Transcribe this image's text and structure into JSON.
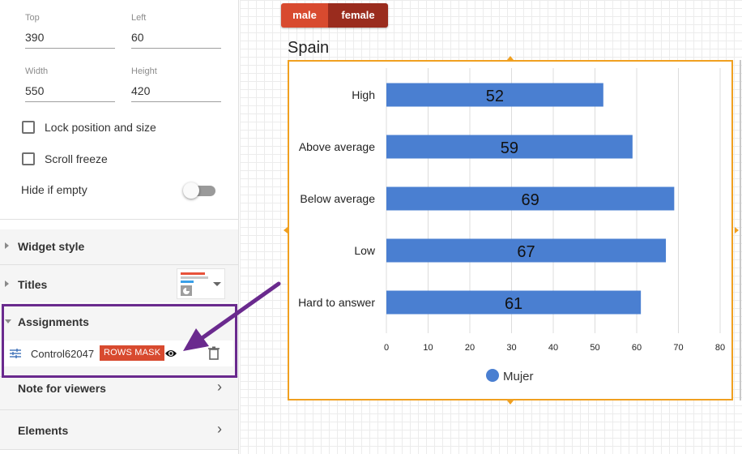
{
  "panel": {
    "position": {
      "top_label": "Top",
      "top_value": "390",
      "left_label": "Left",
      "left_value": "60",
      "width_label": "Width",
      "width_value": "550",
      "height_label": "Height",
      "height_value": "420"
    },
    "lock_label": "Lock position and size",
    "scroll_freeze_label": "Scroll freeze",
    "hide_if_empty_label": "Hide if empty",
    "sections": {
      "widget_style": "Widget style",
      "titles": "Titles",
      "assignments": "Assignments",
      "note_for_viewers": "Note for viewers",
      "elements": "Elements"
    },
    "assignment": {
      "name": "Control62047",
      "badge": "ROWS MASK"
    }
  },
  "filter_buttons": {
    "male": "male",
    "female": "female"
  },
  "chart_data": {
    "type": "bar",
    "orientation": "horizontal",
    "title": "Spain",
    "categories": [
      "High",
      "Above average",
      "Below average",
      "Low",
      "Hard to answer"
    ],
    "series": [
      {
        "name": "Mujer",
        "values": [
          52,
          59,
          69,
          67,
          61
        ],
        "color": "#4a7fd1"
      }
    ],
    "xlim": [
      0,
      80
    ],
    "x_ticks": [
      0,
      10,
      20,
      30,
      40,
      50,
      60,
      70,
      80
    ],
    "grid": "vertical",
    "legend_position": "bottom-center",
    "data_labels": "inside-bar-center"
  },
  "colors": {
    "accent_red": "#d84a2f",
    "dark_red": "#9a2c1e",
    "selection_orange": "#f0a020",
    "annotation_purple": "#6a2a8e",
    "bar_blue": "#4a7fd1"
  },
  "icons": [
    "triangle-right-icon",
    "triangle-down-icon",
    "sliders-icon",
    "eye-icon",
    "trash-icon",
    "chevron-right-icon",
    "chevron-down-icon",
    "chart-titles-icon",
    "arrow-annotation-icon"
  ]
}
